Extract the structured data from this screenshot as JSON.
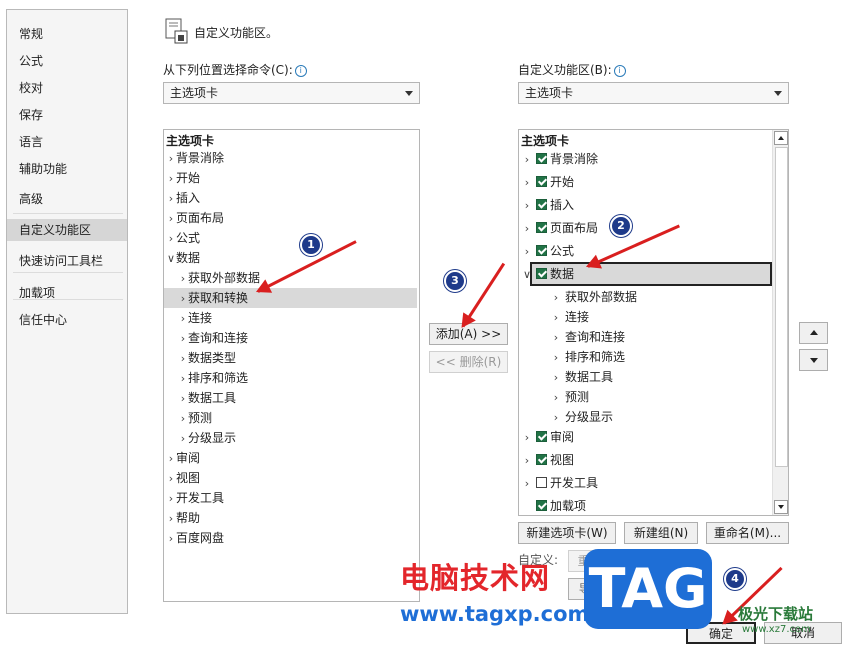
{
  "nav": {
    "items": [
      {
        "label": "常规"
      },
      {
        "label": "公式"
      },
      {
        "label": "校对"
      },
      {
        "label": "保存"
      },
      {
        "label": "语言"
      },
      {
        "label": "辅助功能"
      },
      {
        "label": "高级"
      },
      {
        "label": "自定义功能区",
        "selected": true
      },
      {
        "label": "快速访问工具栏"
      },
      {
        "label": "加载项"
      },
      {
        "label": "信任中心"
      }
    ]
  },
  "header": {
    "title": "自定义功能区。"
  },
  "left": {
    "label": "从下列位置选择命令(C):",
    "combo_value": "主选项卡",
    "list_header": "主选项卡",
    "rows": [
      {
        "label": "背景消除",
        "chev": ">"
      },
      {
        "label": "开始",
        "chev": ">"
      },
      {
        "label": "插入",
        "chev": ">"
      },
      {
        "label": "页面布局",
        "chev": ">"
      },
      {
        "label": "公式",
        "chev": ">"
      },
      {
        "label": "数据",
        "chev": "v"
      },
      {
        "label": "获取外部数据",
        "chev": ">"
      },
      {
        "label": "获取和转换",
        "chev": ">",
        "selected": true
      },
      {
        "label": "连接",
        "chev": ">"
      },
      {
        "label": "查询和连接",
        "chev": ">"
      },
      {
        "label": "数据类型",
        "chev": ">"
      },
      {
        "label": "排序和筛选",
        "chev": ">"
      },
      {
        "label": "数据工具",
        "chev": ">"
      },
      {
        "label": "预测",
        "chev": ">"
      },
      {
        "label": "分级显示",
        "chev": ">"
      },
      {
        "label": "审阅",
        "chev": ">"
      },
      {
        "label": "视图",
        "chev": ">"
      },
      {
        "label": "开发工具",
        "chev": ">"
      },
      {
        "label": "帮助",
        "chev": ">"
      },
      {
        "label": "百度网盘",
        "chev": ">"
      }
    ]
  },
  "middle": {
    "add_label": "添加(A) >>",
    "remove_label": "<< 删除(R)"
  },
  "right": {
    "label": "自定义功能区(B):",
    "combo_value": "主选项卡",
    "list_header": "主选项卡",
    "rows": [
      {
        "label": "背景消除",
        "chev": ">",
        "checked": true
      },
      {
        "label": "开始",
        "chev": ">",
        "checked": true
      },
      {
        "label": "插入",
        "chev": ">",
        "checked": true
      },
      {
        "label": "页面布局",
        "chev": ">",
        "checked": true
      },
      {
        "label": "公式",
        "chev": ">",
        "checked": true
      },
      {
        "label": "数据",
        "chev": "v",
        "checked": true,
        "selected": true
      },
      {
        "label": "获取外部数据",
        "chev": ">"
      },
      {
        "label": "连接",
        "chev": ">"
      },
      {
        "label": "查询和连接",
        "chev": ">"
      },
      {
        "label": "排序和筛选",
        "chev": ">"
      },
      {
        "label": "数据工具",
        "chev": ">"
      },
      {
        "label": "预测",
        "chev": ">"
      },
      {
        "label": "分级显示",
        "chev": ">"
      },
      {
        "label": "审阅",
        "chev": ">",
        "checked": true
      },
      {
        "label": "视图",
        "chev": ">",
        "checked": true
      },
      {
        "label": "开发工具",
        "chev": ">",
        "checked": false
      },
      {
        "label": "加载项",
        "chev": "",
        "checked": true
      }
    ],
    "new_tab": "新建选项卡(W)",
    "new_group": "新建组(N)",
    "rename": "重命名(M)...",
    "customize_label": "自定义:",
    "reset": "重置(E) ▾",
    "import_export": "导入/导出(P) ▾"
  },
  "footer": {
    "ok": "确定",
    "cancel": "取消"
  },
  "annotations": {
    "b1": "1",
    "b2": "2",
    "b3": "3",
    "b4": "4"
  },
  "watermark": {
    "cn": "电脑技术网",
    "url": "www.tagxp.com",
    "tag": "TAG",
    "site2_cn": "极光下载站",
    "site2_url": "www.xz7.com"
  },
  "colors": {
    "check": "#217346",
    "arrow": "#d91f1f",
    "badge": "#1e3a8a",
    "tag_blue": "#1e6ed6",
    "wm_red": "#e3262b"
  }
}
